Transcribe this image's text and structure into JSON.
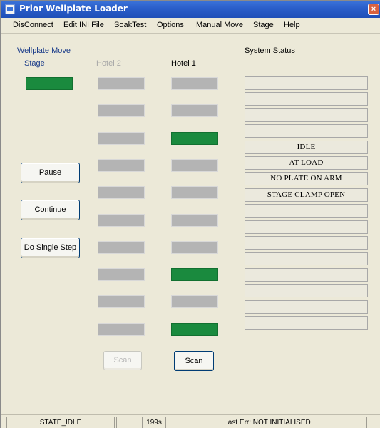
{
  "window": {
    "title": "Prior Wellplate Loader",
    "close_glyph": "×"
  },
  "menu": [
    "DisConnect",
    "Edit INI File",
    "SoakTest",
    "Options",
    "Manual Move",
    "Stage",
    "Help"
  ],
  "panel": {
    "group_label": "Wellplate Move",
    "stage_label": "Stage",
    "hotel2_label": "Hotel 2",
    "hotel1_label": "Hotel 1",
    "system_status_label": "System Status"
  },
  "stage_slot_loaded": true,
  "hotel2_slots_loaded": [
    false,
    false,
    false,
    false,
    false,
    false,
    false,
    false,
    false,
    false
  ],
  "hotel1_slots_loaded": [
    false,
    false,
    true,
    false,
    false,
    false,
    false,
    true,
    false,
    true
  ],
  "buttons": {
    "pause": "Pause",
    "continue": "Continue",
    "single_step": "Do Single Step",
    "scan_hotel2": "Scan",
    "scan_hotel1": "Scan"
  },
  "system_status": [
    "",
    "",
    "",
    "",
    "IDLE",
    "AT LOAD",
    "NO PLATE ON ARM",
    "STAGE CLAMP OPEN",
    "",
    "",
    "",
    "",
    "",
    "",
    "",
    ""
  ],
  "statusbar": {
    "state": "STATE_IDLE",
    "blank": "",
    "time": "199s",
    "last_error": "Last Err: NOT INITIALISED"
  },
  "colors": {
    "loaded_slot": "#1a8a3e",
    "empty_slot": "#b4b4b4",
    "titlebar": "#2a5ec9"
  }
}
